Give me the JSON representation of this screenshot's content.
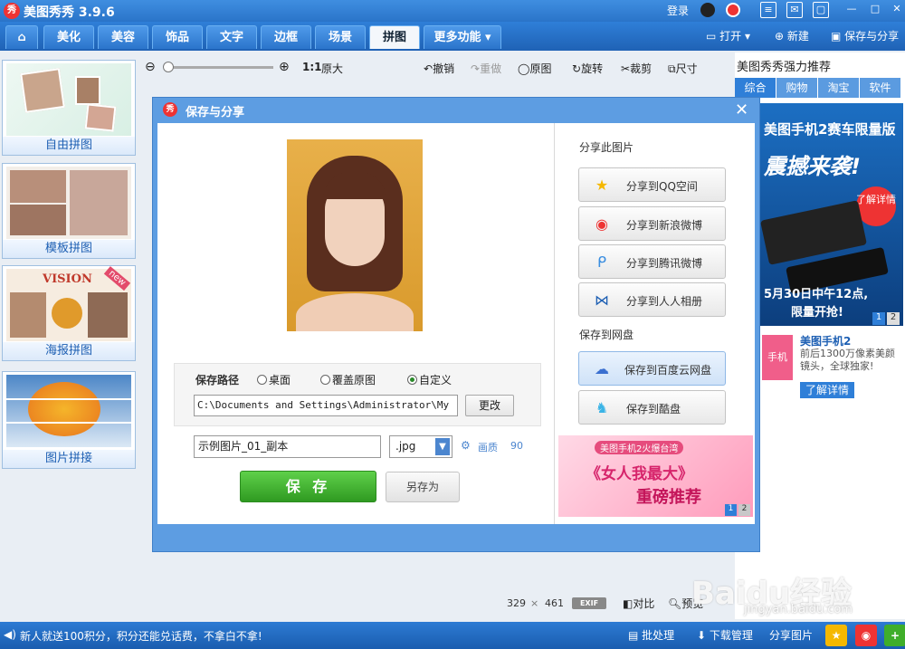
{
  "app": {
    "title": "美图秀秀 3.9.6",
    "logo_text": "秀"
  },
  "titlebar": {
    "login": "登录"
  },
  "tabs": [
    {
      "label": "美化"
    },
    {
      "label": "美容"
    },
    {
      "label": "饰品"
    },
    {
      "label": "文字"
    },
    {
      "label": "边框"
    },
    {
      "label": "场景"
    },
    {
      "label": "拼图"
    },
    {
      "label": "更多功能"
    }
  ],
  "top_actions": {
    "open": "打开",
    "new": "新建",
    "save_share": "保存与分享"
  },
  "left_panel": [
    {
      "label": "自由拼图",
      "badge": ""
    },
    {
      "label": "模板拼图",
      "badge": ""
    },
    {
      "label": "海报拼图",
      "badge": "new",
      "poster_text": "VISION"
    },
    {
      "label": "图片拼接",
      "badge": ""
    }
  ],
  "toolbar": {
    "zoom_ratio": "1:1",
    "actual_size": "原大",
    "undo": "撤销",
    "redo": "重做",
    "original": "原图",
    "rotate": "旋转",
    "crop": "裁剪",
    "size": "尺寸"
  },
  "right_panel": {
    "title": "美图秀秀强力推荐",
    "tabs": [
      "综合",
      "购物",
      "淘宝",
      "软件"
    ],
    "ad_headline": "美图手机2赛车限量版",
    "ad_big": "震撼来袭!",
    "ad_badge": "了解详情",
    "ad_date": "5月30日中午12点,",
    "ad_limited": "限量开抢!",
    "ad_pages": [
      "1",
      "2"
    ],
    "ad2_title": "美图手机2",
    "ad2_desc": "前后1300万像素美颜镜头，全球独家!",
    "ad2_button": "了解详情",
    "ad2_side": "手机"
  },
  "dialog": {
    "title": "保存与分享",
    "share_heading": "分享此图片",
    "share_buttons": [
      {
        "label": "分享到QQ空间",
        "icon": "star-icon"
      },
      {
        "label": "分享到新浪微博",
        "icon": "weibo-icon"
      },
      {
        "label": "分享到腾讯微博",
        "icon": "tencent-weibo-icon"
      },
      {
        "label": "分享到人人相册",
        "icon": "renren-icon"
      }
    ],
    "cloud_heading": "保存到网盘",
    "cloud_buttons": [
      {
        "label": "保存到百度云网盘",
        "icon": "baidu-cloud-icon"
      },
      {
        "label": "保存到酷盘",
        "icon": "kupan-icon"
      }
    ],
    "save_path_label": "保存路径",
    "path_options": [
      "桌面",
      "覆盖原图",
      "自定义"
    ],
    "selected_option": "自定义",
    "path_value": "C:\\Documents and Settings\\Administrator\\My",
    "change_button": "更改",
    "filename_value": "示例图片_01_副本",
    "format_value": ".jpg",
    "quality_label": "画质",
    "quality_value": "90",
    "save_button": "保 存",
    "save_as_button": "另存为",
    "banner_top": "美图手机2火爆台湾",
    "banner_main": "《女人我最大》",
    "banner_sub": "重磅推荐",
    "banner_pages": [
      "1",
      "2"
    ]
  },
  "image_info": {
    "width": "329",
    "times": "×",
    "height": "461",
    "exif": "EXIF",
    "compare": "对比",
    "preview": "预览"
  },
  "statusbar": {
    "message": "新人就送100积分，积分还能兑话费，不拿白不拿!",
    "batch": "批处理",
    "download_manager": "下载管理",
    "share_image": "分享图片"
  },
  "watermark": {
    "brand": "Baidu经验",
    "url": "jingyan.baidu.com"
  },
  "colors": {
    "titlebar_blue": "#2a74c9",
    "save_green": "#3fae2a",
    "accent_red": "#e33333"
  }
}
